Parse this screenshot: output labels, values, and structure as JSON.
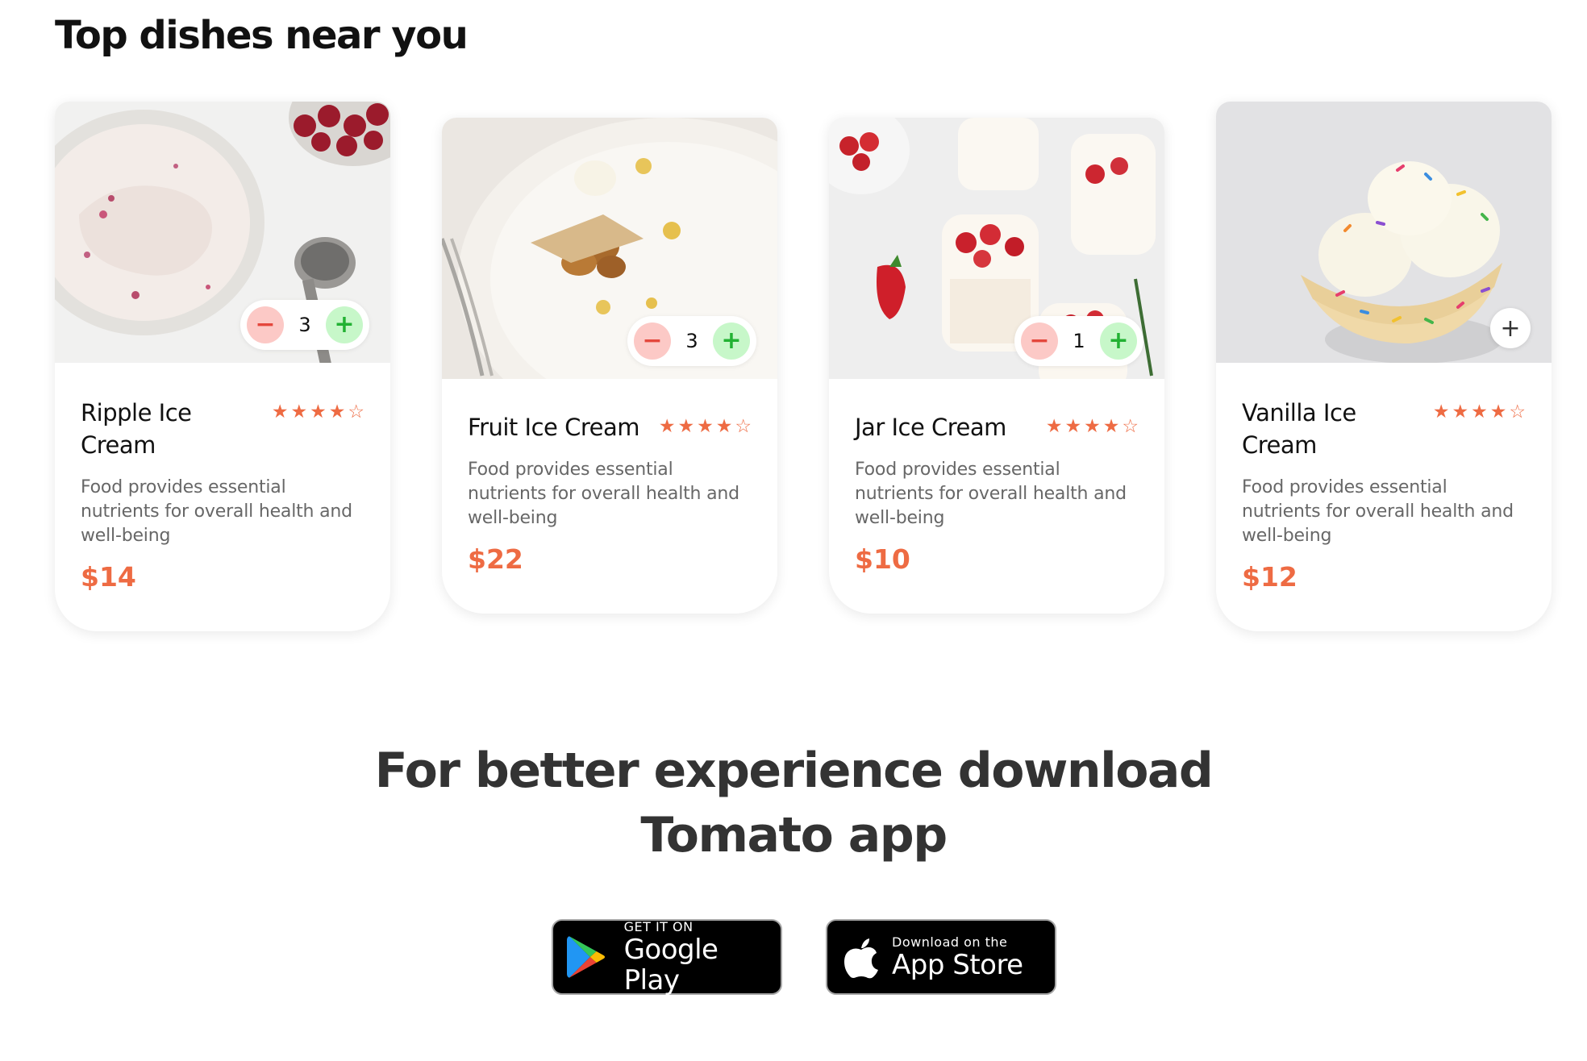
{
  "section": {
    "title": "Top dishes near you"
  },
  "dishes": [
    {
      "name": "Ripple Ice Cream",
      "description": "Food provides essential nutrients for overall health and well-being",
      "price": "$14",
      "rating": 4,
      "quantity": "3",
      "image_icon": "ripple-ice-cream-photo"
    },
    {
      "name": "Fruit Ice Cream",
      "description": "Food provides essential nutrients for overall health and well-being",
      "price": "$22",
      "rating": 4,
      "quantity": "3",
      "image_icon": "fruit-ice-cream-photo"
    },
    {
      "name": "Jar Ice Cream",
      "description": "Food provides essential nutrients for overall health and well-being",
      "price": "$10",
      "rating": 4,
      "quantity": "1",
      "image_icon": "jar-ice-cream-photo"
    },
    {
      "name": "Vanilla Ice Cream",
      "description": "Food provides essential nutrients for overall health and well-being",
      "price": "$12",
      "rating": 4,
      "quantity": null,
      "image_icon": "vanilla-ice-cream-photo"
    }
  ],
  "counter_symbols": {
    "minus": "−",
    "plus": "+",
    "add": "+"
  },
  "star_symbols": {
    "filled": "★",
    "empty": "☆"
  },
  "download": {
    "title_line1": "For better experience download",
    "title_line2": "Tomato app",
    "google_play": {
      "small": "GET IT ON",
      "big": "Google Play"
    },
    "app_store": {
      "small": "Download on the",
      "big": "App Store"
    }
  },
  "colors": {
    "accent": "#ee6b43",
    "minus_bg": "#fcc9c6",
    "plus_bg": "#c7f7c9"
  }
}
